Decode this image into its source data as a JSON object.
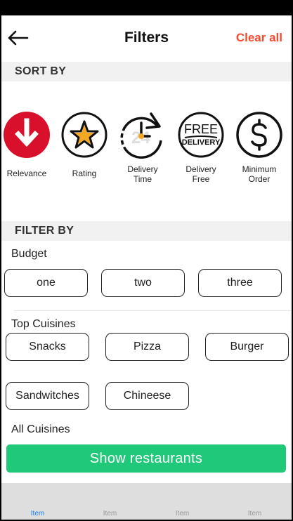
{
  "header": {
    "title": "Filters",
    "clear_label": "Clear all"
  },
  "sort": {
    "heading": "SORT BY",
    "items": [
      {
        "label": "Relevance",
        "icon": "arrow-down-circle-icon"
      },
      {
        "label": "Rating",
        "icon": "star-circle-icon"
      },
      {
        "label": "Delivery Time",
        "icon": "clock-24-icon"
      },
      {
        "label": "Delivery Free",
        "icon": "free-delivery-icon"
      },
      {
        "label": "Minimum Order",
        "icon": "dollar-circle-icon"
      }
    ],
    "relevance_lines": [
      "Relevance"
    ],
    "rating_lines": [
      "Rating"
    ],
    "time_lines": [
      "Delivery",
      "Time"
    ],
    "free_lines": [
      "Delivery",
      "Free"
    ],
    "min_lines": [
      "Minimum",
      "Order"
    ],
    "free_badge": [
      "FREE",
      "DELIVERY"
    ],
    "clock_badge": "24"
  },
  "filter": {
    "heading": "FILTER BY",
    "budget": {
      "title": "Budget",
      "options": [
        "one",
        "two",
        "three"
      ]
    },
    "top_cuisines": {
      "title": "Top Cuisines",
      "options": [
        "Snacks",
        "Pizza",
        "Burger",
        "Sandwitches",
        "Chineese"
      ]
    },
    "all_cuisines": {
      "title": "All Cuisines"
    }
  },
  "cta": {
    "label": "Show restaurants"
  },
  "tabs": [
    "Item",
    "Item",
    "Item",
    "Item"
  ],
  "colors": {
    "accent_red": "#f44a2f",
    "relevance_red": "#d8102b",
    "cta_green": "#20c87a",
    "star_orange": "#f5a623",
    "tab_active": "#1b7ff5"
  }
}
